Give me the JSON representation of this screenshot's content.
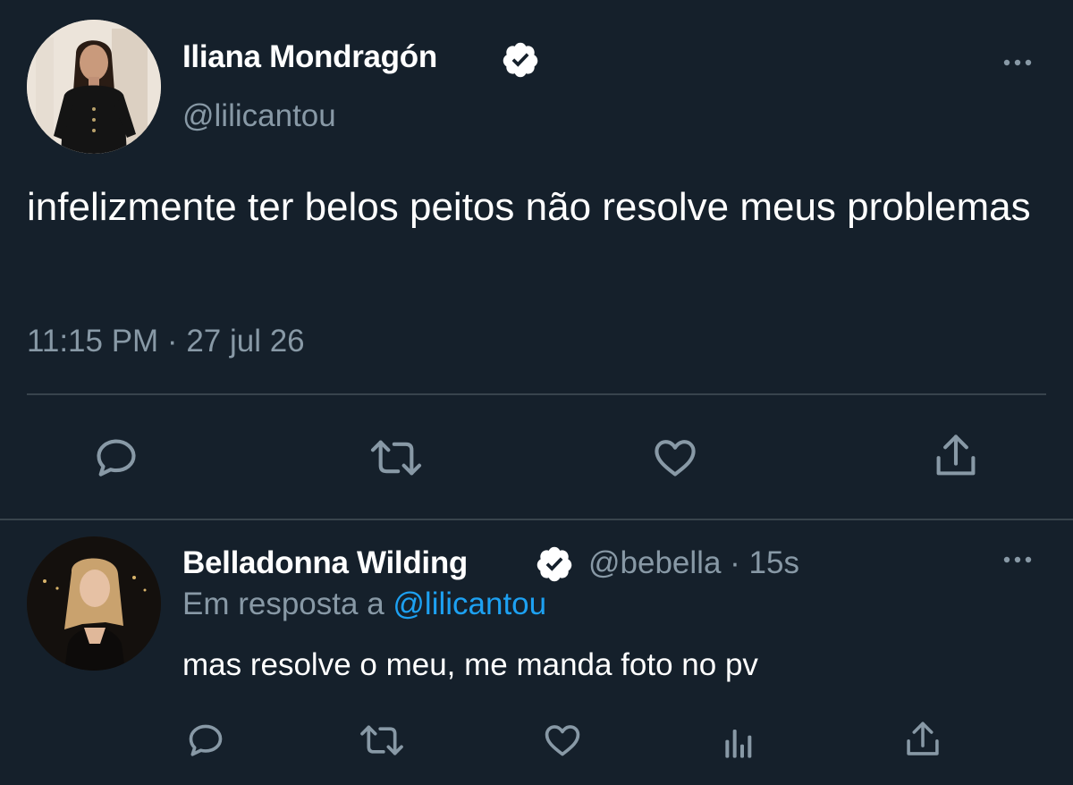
{
  "main_tweet": {
    "author_name": "Iliana Mondragón",
    "author_handle": "@lilicantou",
    "verified": true,
    "text": "infelizmente ter belos peitos não resolve meus problemas",
    "meta": "11:15 PM · 27 jul 26",
    "actions": [
      "reply-icon",
      "retweet-icon",
      "like-icon",
      "share-icon"
    ]
  },
  "reply_tweet": {
    "author_name": "Belladonna Wilding",
    "handle_time": "@bebella · 15s",
    "verified": true,
    "reply_prefix": "Em resposta a ",
    "reply_mention": "@lilicantou",
    "text": "mas resolve o meu, me manda foto no pv",
    "actions": [
      "reply-icon",
      "retweet-icon",
      "like-icon",
      "analytics-icon",
      "share-icon"
    ]
  },
  "colors": {
    "background": "#15202b",
    "primary_text": "#ffffff",
    "secondary_text": "#8899a6",
    "link": "#1da1f2",
    "divider": "#38444d"
  }
}
